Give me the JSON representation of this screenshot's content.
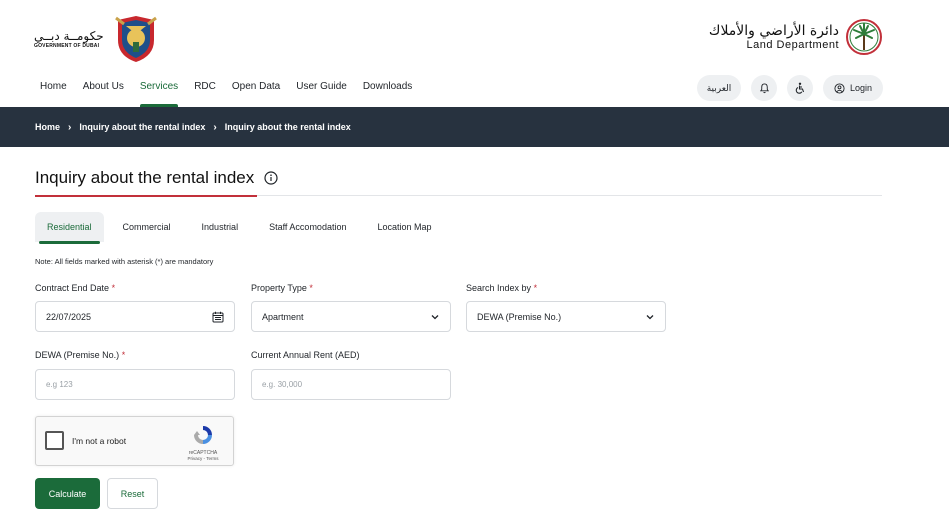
{
  "header": {
    "gov_logo_arabic": "حكومــة دبــي",
    "gov_logo_english": "GOVERNMENT OF DUBAI",
    "dld_logo_arabic": "دائرة الأراضي والأملاك",
    "dld_logo_english": "Land Department"
  },
  "nav": {
    "items": [
      "Home",
      "About Us",
      "Services",
      "RDC",
      "Open Data",
      "User Guide",
      "Downloads"
    ],
    "active": "Services"
  },
  "utility": {
    "language_label": "العربية",
    "notifications_icon": "bell-icon",
    "accessibility_icon": "accessibility-icon",
    "login_label": "Login",
    "login_icon": "user-circle-icon"
  },
  "breadcrumb": [
    "Home",
    "Inquiry about the rental index",
    "Inquiry about the rental index"
  ],
  "page": {
    "title": "Inquiry about the rental index",
    "info_icon": "info-icon"
  },
  "tabs": [
    "Residential",
    "Commercial",
    "Industrial",
    "Staff Accomodation",
    "Location Map"
  ],
  "active_tab": "Residential",
  "form": {
    "note": "Note: All fields marked with asterisk (*) are mandatory",
    "contract_end_date": {
      "label": "Contract End Date",
      "required": "*",
      "value": "22/07/2025"
    },
    "property_type": {
      "label": "Property Type",
      "required": "*",
      "value": "Apartment"
    },
    "search_index_by": {
      "label": "Search Index by",
      "required": "*",
      "value": "DEWA (Premise No.)"
    },
    "dewa": {
      "label": "DEWA (Premise No.)",
      "required": "*",
      "placeholder": "e.g 123"
    },
    "annual_rent": {
      "label": "Current Annual Rent (AED)",
      "placeholder": "e.g. 30,000"
    }
  },
  "captcha": {
    "label": "I'm not a robot",
    "brand": "reCAPTCHA",
    "links": "Privacy - Terms"
  },
  "buttons": {
    "calculate": "Calculate",
    "reset": "Reset"
  },
  "colors": {
    "brand_green": "#1b6b3a",
    "breadcrumb_bg": "#27323f",
    "accent_red": "#c2303a"
  }
}
